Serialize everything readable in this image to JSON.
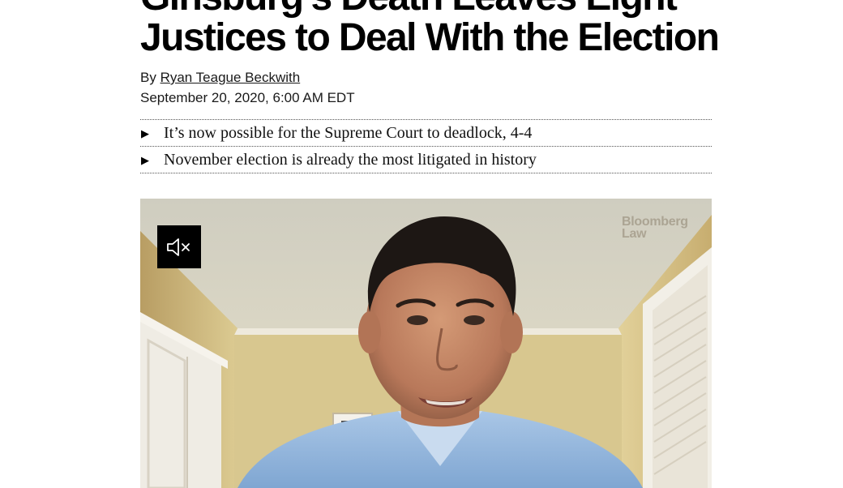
{
  "article": {
    "headline": "Ginsburg’s Death Leaves Eight Justices to Deal With the Election",
    "byline_prefix": "By ",
    "author": "Ryan Teague Beckwith",
    "date": "September 20, 2020, 6:00 AM EDT",
    "bullets": [
      "It’s now possible for the Supreme Court to deadlock, 4-4",
      "November election is already the most litigated in history"
    ]
  },
  "video": {
    "watermark": "Bloomberg Law",
    "mute_icon": "speaker-muted-icon"
  }
}
